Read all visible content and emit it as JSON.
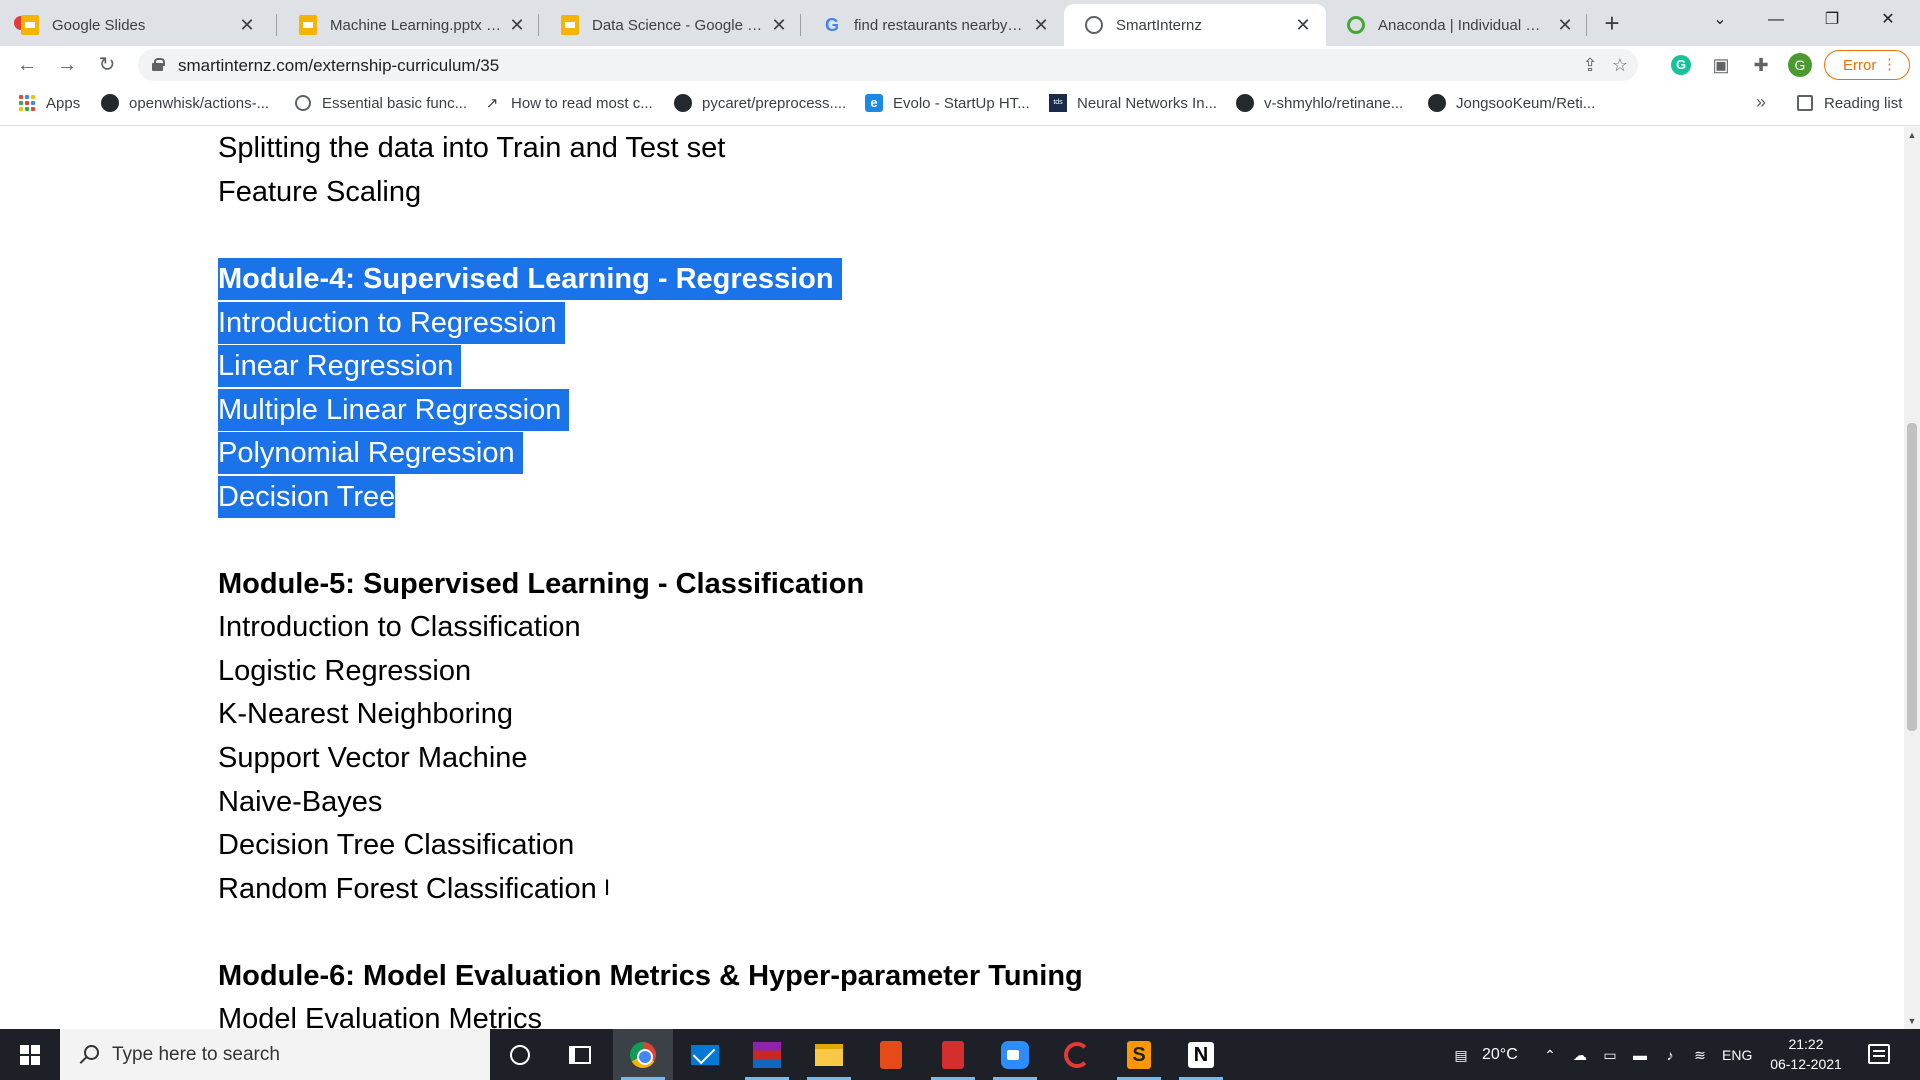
{
  "browser": {
    "tabs": [
      {
        "title": "Google Slides",
        "icon": "google-slides-icon",
        "active": false
      },
      {
        "title": "Machine Learning.pptx - Go",
        "icon": "google-slides-icon",
        "active": false
      },
      {
        "title": "Data Science - Google Slide",
        "icon": "google-slides-icon",
        "active": false
      },
      {
        "title": "find restaurants nearby - G",
        "icon": "google-icon",
        "active": false
      },
      {
        "title": "SmartInternz",
        "icon": "globe-icon",
        "active": true
      },
      {
        "title": "Anaconda | Individual Editio",
        "icon": "anaconda-icon",
        "active": false
      }
    ],
    "tab_close_glyph": "✕",
    "new_tab_glyph": "+",
    "window_controls": {
      "minimize": "—",
      "restore": "❐",
      "close": "✕",
      "tab_search": "⌄"
    },
    "address_bar": {
      "url": "smartinternz.com/externship-curriculum/35"
    },
    "profile_initial": "G",
    "error_label": "Error",
    "bookmarks": [
      {
        "label": "Apps",
        "icon": "apps-grid-icon"
      },
      {
        "label": "openwhisk/actions-...",
        "icon": "github-icon"
      },
      {
        "label": "Essential basic func...",
        "icon": "globe-icon"
      },
      {
        "label": "How to read most c...",
        "icon": "chart-line-icon"
      },
      {
        "label": "pycaret/preprocess....",
        "icon": "github-icon"
      },
      {
        "label": "Evolo - StartUp HT...",
        "icon": "edge-icon"
      },
      {
        "label": "Neural Networks In...",
        "icon": "tds-icon"
      },
      {
        "label": "v-shmyhlo/retinane...",
        "icon": "github-icon"
      },
      {
        "label": "JongsooKeum/Reti...",
        "icon": "github-icon"
      }
    ],
    "bookmarks_overflow": "»",
    "reading_list": "Reading list"
  },
  "curriculum": {
    "lines": [
      {
        "text": "Splitting the data into Train and Test set",
        "heading": false,
        "selected": false
      },
      {
        "text": "Feature Scaling",
        "heading": false,
        "selected": false
      },
      {
        "text": "Module-4: Supervised Learning - Regression",
        "heading": true,
        "selected": true
      },
      {
        "text": "Introduction to Regression",
        "heading": false,
        "selected": true
      },
      {
        "text": "Linear Regression",
        "heading": false,
        "selected": true
      },
      {
        "text": "Multiple Linear Regression",
        "heading": false,
        "selected": true
      },
      {
        "text": "Polynomial Regression",
        "heading": false,
        "selected": true
      },
      {
        "text": "Decision Tree",
        "heading": false,
        "selected": true
      },
      {
        "text": "Module-5: Supervised Learning - Classification",
        "heading": true,
        "selected": false
      },
      {
        "text": "Introduction to Classification",
        "heading": false,
        "selected": false
      },
      {
        "text": "Logistic Regression",
        "heading": false,
        "selected": false
      },
      {
        "text": "K-Nearest Neighboring",
        "heading": false,
        "selected": false
      },
      {
        "text": "Support Vector Machine",
        "heading": false,
        "selected": false
      },
      {
        "text": "Naive-Bayes",
        "heading": false,
        "selected": false
      },
      {
        "text": "Decision Tree Classification",
        "heading": false,
        "selected": false
      },
      {
        "text": "Random Forest Classification",
        "heading": false,
        "selected": false
      },
      {
        "text": "Module-6: Model Evaluation Metrics & Hyper-parameter Tuning",
        "heading": true,
        "selected": false
      },
      {
        "text": "Model Evaluation Metrics",
        "heading": false,
        "selected": false
      }
    ],
    "selection_color": "#1a73e8",
    "text_cursor_glyph": "I"
  },
  "taskbar": {
    "search_placeholder": "Type here to search",
    "apps": [
      "cortana-icon",
      "task-view-icon",
      "chrome-icon",
      "mail-icon",
      "winrar-icon",
      "file-explorer-icon",
      "office-icon",
      "office-red-icon",
      "zoom-icon",
      "spiral-app-icon",
      "sublime-text-icon",
      "notion-icon"
    ],
    "weather": "20°C",
    "language": "ENG",
    "time": "21:22",
    "date": "06-12-2021"
  }
}
